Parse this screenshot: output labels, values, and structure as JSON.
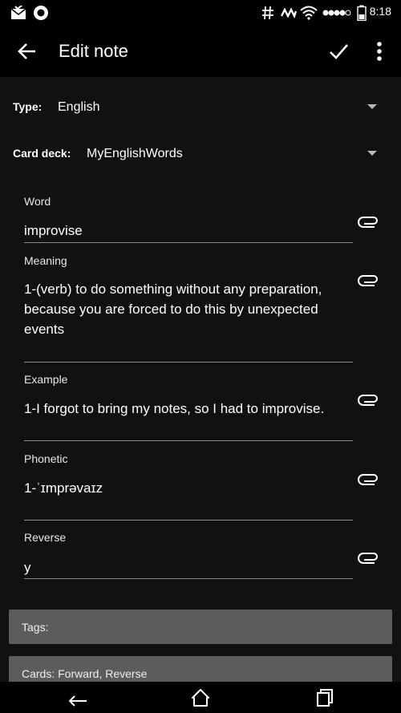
{
  "status_bar": {
    "time": "8:18",
    "icons": [
      "mail-check-icon",
      "circle-app-icon",
      "hash-icon",
      "activity-icon",
      "wifi-icon",
      "signal-dots-icon",
      "battery-icon"
    ]
  },
  "app_bar": {
    "title": "Edit note",
    "icons": [
      "back-arrow-icon",
      "check-icon",
      "more-vert-icon"
    ]
  },
  "type_row": {
    "label": "Type:",
    "value": "English"
  },
  "deck_row": {
    "label": "Card deck:",
    "value": "MyEnglishWords"
  },
  "fields": [
    {
      "label": "Word",
      "value": "improvise"
    },
    {
      "label": "Meaning",
      "value": "1-(verb) to do something without any preparation, because you are forced to do this by unexpected events"
    },
    {
      "label": "Example",
      "value": "1-I forgot to bring my notes, so I had to improvise."
    },
    {
      "label": "Phonetic",
      "value": "1-ˈɪmprəvaɪz"
    },
    {
      "label": "Reverse",
      "value": "y"
    }
  ],
  "tags": {
    "label": "Tags:"
  },
  "cards": {
    "label": "Cards: Forward, Reverse"
  },
  "nav_bar": {
    "icons": [
      "nav-back-icon",
      "nav-home-icon",
      "nav-recents-icon"
    ]
  },
  "colors": {
    "background": "#111111",
    "bar": "#000000",
    "button_gray": "#5c5c5c",
    "underline": "#8c8c8c"
  }
}
